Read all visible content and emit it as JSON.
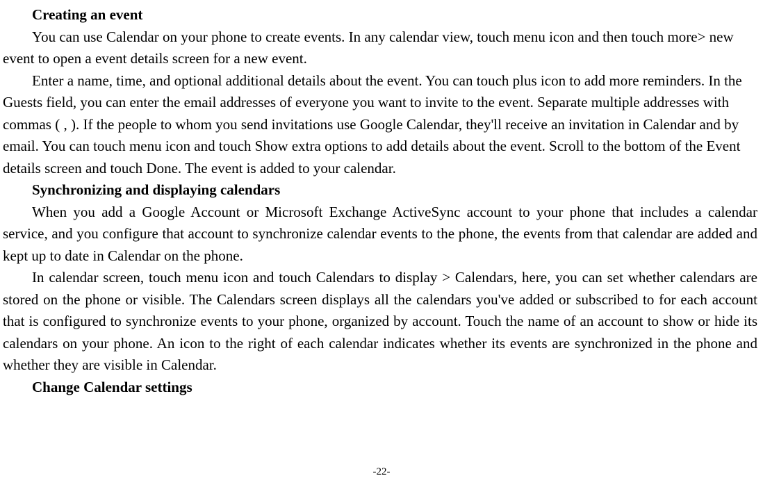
{
  "sections": {
    "creating": {
      "heading": "Creating an event",
      "p1": "You can use Calendar on your phone to create events. In any calendar view, touch menu icon and then touch more> new event to open a event details screen for a new event.",
      "p2": "Enter a name, time, and optional additional details about the event. You can touch plus icon to add more reminders. In the Guests field, you can enter the email addresses of everyone you want to invite to the event. Separate multiple addresses with commas ( , ). If the people to whom you send invitations use Google Calendar, they'll receive an invitation in Calendar and by email. You can touch menu icon and touch Show extra options to add details about the event. Scroll to the bottom of the Event details screen and touch Done. The event is added to your calendar."
    },
    "sync": {
      "heading": "Synchronizing and displaying calendars",
      "p1": "When you add a Google Account or Microsoft Exchange ActiveSync account to your phone that includes a calendar service, and you configure that account to synchronize calendar events to the phone, the events from that calendar are added and kept up to date in Calendar on the phone.",
      "p2": "In calendar screen, touch menu icon and touch Calendars to display > Calendars, here, you can set whether calendars are stored on the phone or visible. The Calendars screen displays all the calendars you've added or subscribed to for each account that is configured to synchronize events to your phone, organized by account. Touch the name of an account to show or hide its calendars on your phone. An icon to the right of each calendar indicates whether its events are synchronized in the phone and whether they are visible in Calendar."
    },
    "settings": {
      "heading": "Change Calendar settings"
    }
  },
  "pageNumber": "-22-"
}
